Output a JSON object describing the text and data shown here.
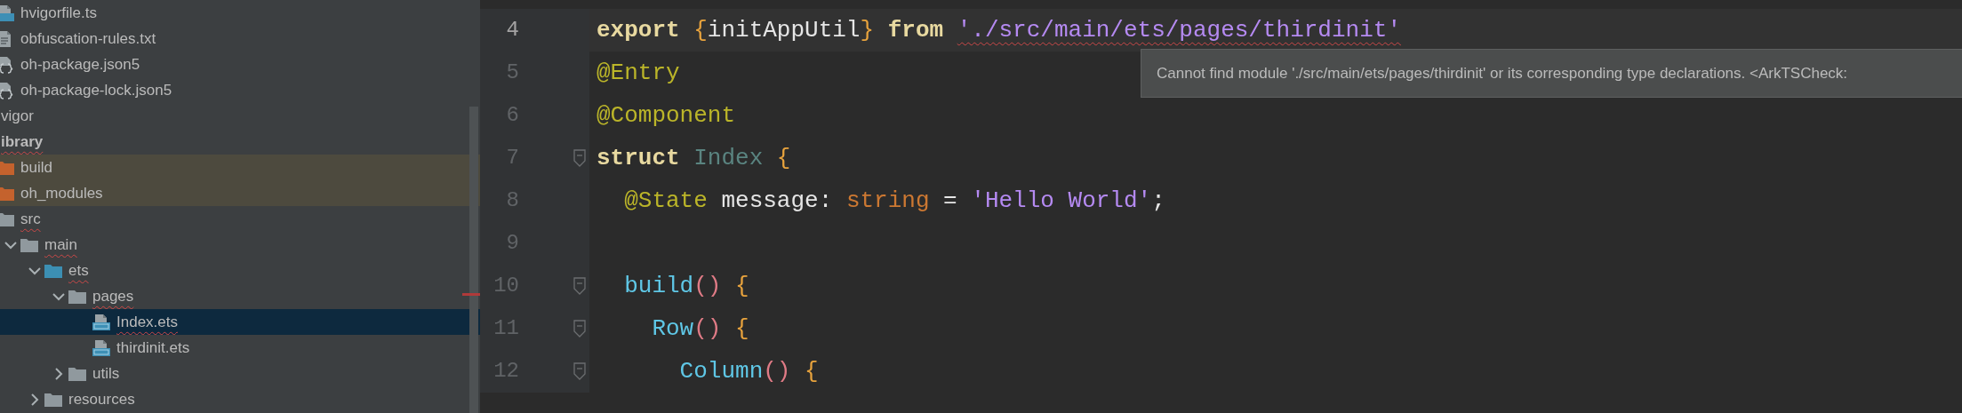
{
  "project_tree": {
    "items": [
      {
        "kind": "continued",
        "children": [
          {
            "kind": "ts-file",
            "label": "hvigorfile.ts"
          },
          {
            "kind": "text-file",
            "label": "obfuscation-rules.txt"
          },
          {
            "kind": "json-file",
            "label": "oh-package.json5"
          },
          {
            "kind": "json-file",
            "label": "oh-package-lock.json5"
          }
        ]
      },
      {
        "kind": "folder",
        "label": "vigor"
      },
      {
        "kind": "module",
        "label": "ibrary",
        "error": true,
        "children": [
          {
            "kind": "excluded-folder",
            "label": "build"
          },
          {
            "kind": "excluded-folder",
            "label": "oh_modules"
          },
          {
            "kind": "folder",
            "label": "src",
            "error": true,
            "children": [
              {
                "kind": "folder",
                "label": "main",
                "error": true,
                "expanded": true,
                "children": [
                  {
                    "kind": "source-folder",
                    "label": "ets",
                    "error": true,
                    "expanded": true,
                    "children": [
                      {
                        "kind": "folder",
                        "label": "pages",
                        "error": true,
                        "expanded": true,
                        "children": [
                          {
                            "kind": "ets-file",
                            "label": "Index.ets",
                            "error": true,
                            "selected": true
                          },
                          {
                            "kind": "ets-file",
                            "label": "thirdinit.ets",
                            "selected": false
                          }
                        ]
                      },
                      {
                        "kind": "folder",
                        "label": "utils",
                        "expanded": false
                      }
                    ]
                  },
                  {
                    "kind": "folder",
                    "label": "resources",
                    "expanded": false
                  }
                ]
              }
            ]
          }
        ]
      }
    ]
  },
  "editor": {
    "lines": [
      {
        "number": "4",
        "current": true,
        "tokens": [
          {
            "kind": "keyword",
            "text": "export "
          },
          {
            "kind": "brace",
            "text": "{"
          },
          {
            "kind": "plain",
            "text": "initAppUtil"
          },
          {
            "kind": "brace",
            "text": "} "
          },
          {
            "kind": "keyword",
            "text": "from "
          },
          {
            "kind": "string",
            "text": "'./src/main/ets/pages/thirdinit'",
            "error": true
          }
        ]
      },
      {
        "number": "5",
        "current": false,
        "tokens": [
          {
            "kind": "decorator",
            "text": "@Entry"
          }
        ]
      },
      {
        "number": "6",
        "current": false,
        "tokens": [
          {
            "kind": "decorator",
            "text": "@Component"
          }
        ]
      },
      {
        "number": "7",
        "current": false,
        "fold": true,
        "tokens": [
          {
            "kind": "keyword",
            "text": "struct "
          },
          {
            "kind": "class",
            "text": "Index "
          },
          {
            "kind": "brace",
            "text": "{"
          }
        ]
      },
      {
        "number": "8",
        "current": false,
        "tokens": [
          {
            "kind": "decorator",
            "text": "  @State "
          },
          {
            "kind": "plain",
            "text": "message: "
          },
          {
            "kind": "type",
            "text": "string "
          },
          {
            "kind": "plain",
            "text": "= "
          },
          {
            "kind": "string",
            "text": "'Hello World'"
          },
          {
            "kind": "plain",
            "text": ";"
          }
        ]
      },
      {
        "number": "9",
        "current": false
      },
      {
        "number": "10",
        "current": false,
        "fold": true,
        "tokens": [
          {
            "kind": "function",
            "text": "  build"
          },
          {
            "kind": "paren",
            "text": "()"
          },
          {
            "kind": "brace",
            "text": " {"
          }
        ]
      },
      {
        "number": "11",
        "current": false,
        "fold": true,
        "tokens": [
          {
            "kind": "function",
            "text": "    Row"
          },
          {
            "kind": "paren",
            "text": "()"
          },
          {
            "kind": "brace",
            "text": " {"
          }
        ]
      },
      {
        "number": "12",
        "current": false,
        "fold": true,
        "tokens": [
          {
            "kind": "function",
            "text": "      Column"
          },
          {
            "kind": "paren",
            "text": "()"
          },
          {
            "kind": "brace",
            "text": " {"
          }
        ]
      }
    ],
    "tooltip": "Cannot find module './src/main/ets/pages/thirdinit' or its corresponding type declarations. <ArkTSCheck:"
  }
}
